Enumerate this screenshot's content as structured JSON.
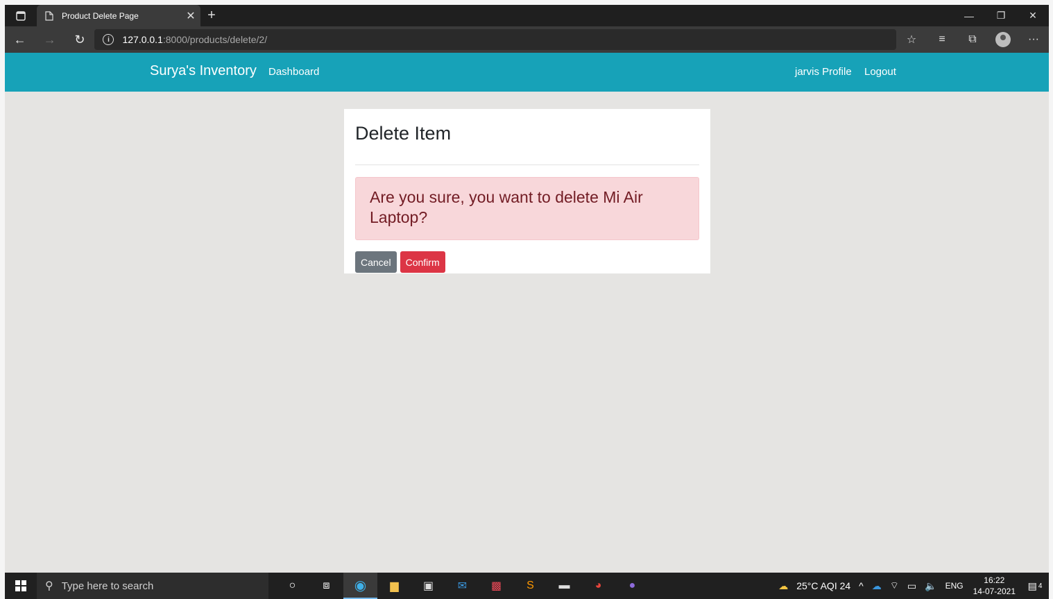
{
  "browser": {
    "tab_title": "Product Delete Page",
    "address_host": "127.0.0.1",
    "address_path": ":8000/products/delete/2/"
  },
  "navbar": {
    "brand": "Surya's Inventory",
    "dashboard": "Dashboard",
    "profile": "jarvis Profile",
    "logout": "Logout"
  },
  "card": {
    "title": "Delete Item",
    "message": "Are you sure, you want to delete Mi Air Laptop?",
    "cancel_label": "Cancel",
    "confirm_label": "Confirm"
  },
  "taskbar": {
    "search_placeholder": "Type here to search",
    "weather": "25°C  AQI 24",
    "language": "ENG",
    "time": "16:22",
    "date": "14-07-2021",
    "notification_count": "4"
  },
  "colors": {
    "navbar_bg": "#17a2b8",
    "alert_bg": "#f8d7da",
    "alert_text": "#721c24",
    "cancel_bg": "#6c757d",
    "confirm_bg": "#dc3545"
  }
}
